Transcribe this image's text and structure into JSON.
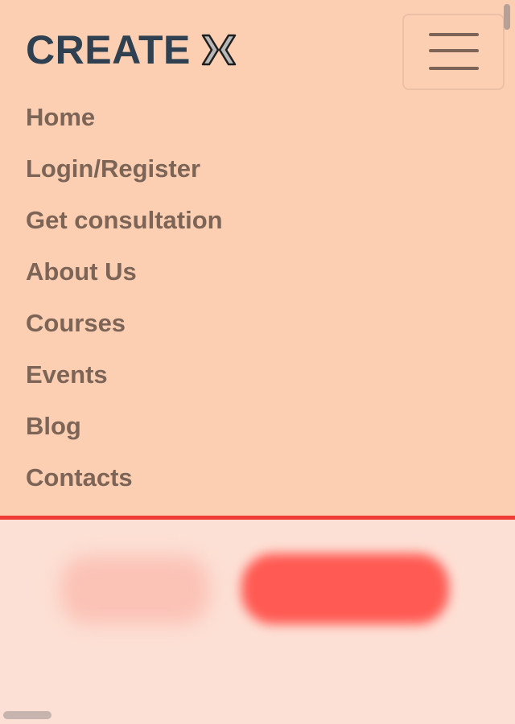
{
  "header": {
    "logo_text": "CREATE",
    "logo_icon": "x-mark-icon",
    "menu_toggle_icon": "hamburger-icon"
  },
  "nav": {
    "items": [
      {
        "label": "Home"
      },
      {
        "label": "Login/Register"
      },
      {
        "label": "Get consultation"
      },
      {
        "label": "About Us"
      },
      {
        "label": "Courses"
      },
      {
        "label": "Events"
      },
      {
        "label": "Blog"
      },
      {
        "label": "Contacts"
      }
    ]
  },
  "colors": {
    "nav_background": "#fccfb3",
    "accent_line": "#ef3d35",
    "nav_text": "#7c6456",
    "logo_text": "#2f4050",
    "primary_button": "#ff5a53",
    "page_background": "#fde0d5"
  }
}
